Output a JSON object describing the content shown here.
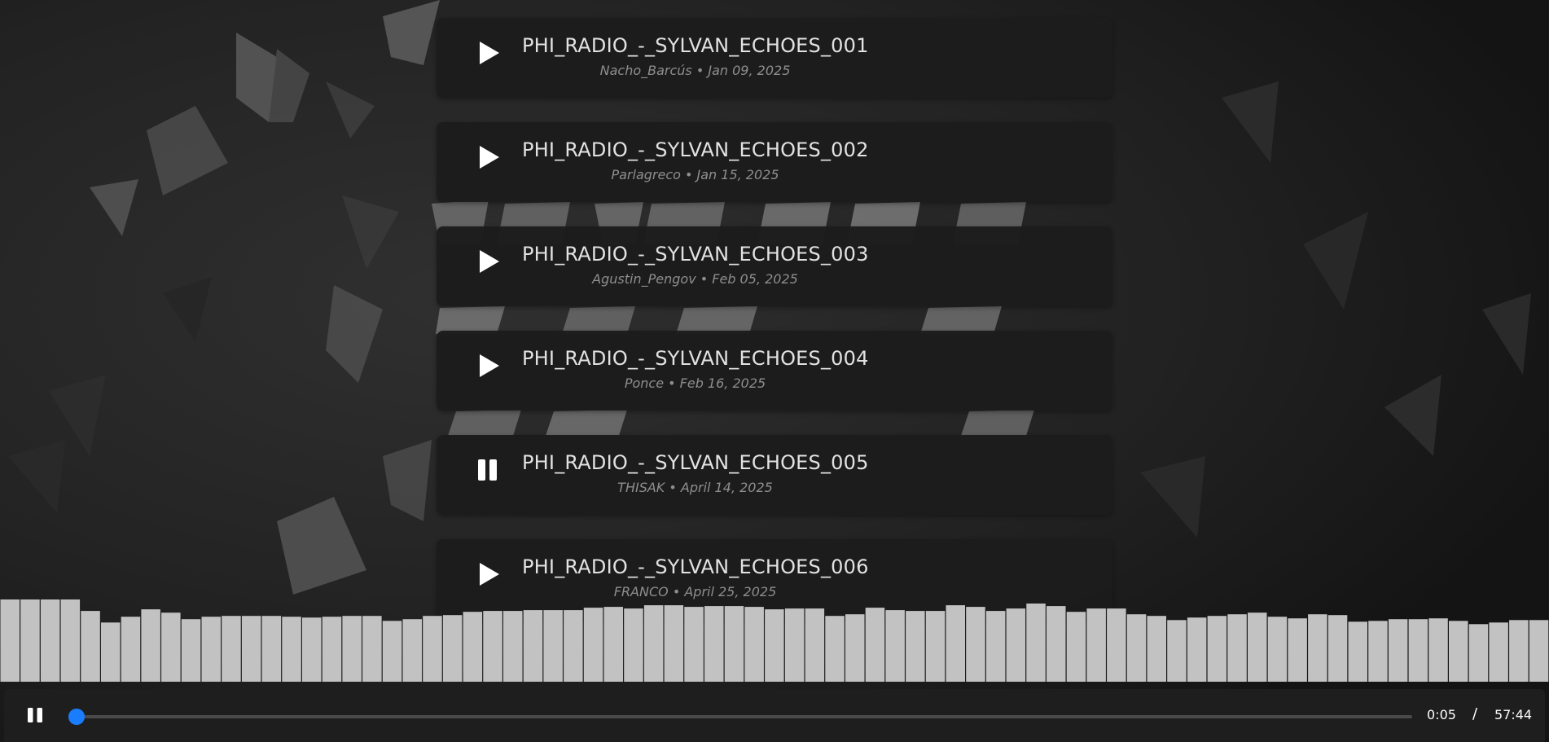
{
  "background": {
    "facets": [
      [
        [
          290,
          40
        ],
        [
          340,
          70
        ],
        [
          330,
          150
        ],
        [
          290,
          120
        ],
        "#5a5a5a"
      ],
      [
        [
          340,
          60
        ],
        [
          380,
          90
        ],
        [
          360,
          150
        ],
        [
          330,
          150
        ],
        "#4a4a4a"
      ],
      [
        [
          470,
          20
        ],
        [
          540,
          0
        ],
        [
          520,
          80
        ],
        [
          480,
          70
        ],
        "#5e5e5e"
      ],
      [
        [
          180,
          160
        ],
        [
          240,
          130
        ],
        [
          280,
          200
        ],
        [
          200,
          240
        ],
        "#4c4c4c"
      ],
      [
        [
          110,
          230
        ],
        [
          170,
          220
        ],
        [
          150,
          290
        ],
        "#555555"
      ],
      [
        [
          400,
          100
        ],
        [
          460,
          130
        ],
        [
          430,
          170
        ],
        "#3e3e3e"
      ],
      [
        [
          420,
          240
        ],
        [
          490,
          260
        ],
        [
          450,
          330
        ],
        "#3a3a3a"
      ],
      [
        [
          410,
          350
        ],
        [
          470,
          380
        ],
        [
          440,
          470
        ],
        [
          400,
          430
        ],
        "#4e4e4e"
      ],
      [
        [
          340,
          640
        ],
        [
          410,
          610
        ],
        [
          450,
          700
        ],
        [
          360,
          730
        ],
        "#555555"
      ],
      [
        [
          470,
          560
        ],
        [
          530,
          540
        ],
        [
          520,
          640
        ],
        [
          480,
          620
        ],
        "#4a4a4a"
      ],
      [
        [
          530,
          250
        ],
        [
          600,
          245
        ],
        [
          590,
          300
        ],
        [
          540,
          300
        ],
        "#6e6e6e"
      ],
      [
        [
          620,
          250
        ],
        [
          700,
          248
        ],
        [
          690,
          300
        ],
        [
          610,
          300
        ],
        "#6a6a6a"
      ],
      [
        [
          730,
          250
        ],
        [
          790,
          248
        ],
        [
          780,
          300
        ],
        [
          740,
          300
        ],
        "#707070"
      ],
      [
        [
          800,
          250
        ],
        [
          890,
          248
        ],
        [
          880,
          300
        ],
        [
          790,
          300
        ],
        "#6c6c6c"
      ],
      [
        [
          940,
          250
        ],
        [
          1020,
          248
        ],
        [
          1010,
          300
        ],
        [
          930,
          300
        ],
        "#747474"
      ],
      [
        [
          1050,
          250
        ],
        [
          1130,
          248
        ],
        [
          1120,
          300
        ],
        [
          1040,
          300
        ],
        "#7a7a7a"
      ],
      [
        [
          1180,
          250
        ],
        [
          1260,
          248
        ],
        [
          1250,
          300
        ],
        [
          1170,
          300
        ],
        "#686868"
      ],
      [
        [
          540,
          378
        ],
        [
          620,
          376
        ],
        [
          610,
          410
        ],
        [
          535,
          410
        ],
        "#767676"
      ],
      [
        [
          700,
          378
        ],
        [
          780,
          376
        ],
        [
          770,
          410
        ],
        [
          690,
          410
        ],
        "#6a6a6a"
      ],
      [
        [
          840,
          378
        ],
        [
          930,
          376
        ],
        [
          920,
          410
        ],
        [
          830,
          410
        ],
        "#707070"
      ],
      [
        [
          1140,
          378
        ],
        [
          1230,
          376
        ],
        [
          1220,
          410
        ],
        [
          1130,
          410
        ],
        "#6e6e6e"
      ],
      [
        [
          560,
          505
        ],
        [
          640,
          503
        ],
        [
          630,
          535
        ],
        [
          550,
          535
        ],
        "#6a6a6a"
      ],
      [
        [
          680,
          505
        ],
        [
          770,
          503
        ],
        [
          760,
          535
        ],
        [
          670,
          535
        ],
        "#727272"
      ],
      [
        [
          1190,
          505
        ],
        [
          1270,
          503
        ],
        [
          1260,
          535
        ],
        [
          1180,
          535
        ],
        "#6a6a6a"
      ],
      [
        [
          1500,
          120
        ],
        [
          1570,
          100
        ],
        [
          1560,
          200
        ],
        "#2e2e2e"
      ],
      [
        [
          1600,
          300
        ],
        [
          1680,
          260
        ],
        [
          1650,
          380
        ],
        "#2a2a2a"
      ],
      [
        [
          1700,
          500
        ],
        [
          1770,
          460
        ],
        [
          1760,
          560
        ],
        "#303030"
      ],
      [
        [
          1400,
          580
        ],
        [
          1480,
          560
        ],
        [
          1470,
          660
        ],
        "#2c2c2c"
      ],
      [
        [
          1820,
          380
        ],
        [
          1880,
          360
        ],
        [
          1870,
          460
        ],
        "#2e2e2e"
      ],
      [
        [
          60,
          480
        ],
        [
          130,
          460
        ],
        [
          110,
          560
        ],
        "#2e2e2e"
      ],
      [
        [
          10,
          560
        ],
        [
          80,
          540
        ],
        [
          70,
          630
        ],
        "#2a2a2a"
      ],
      [
        [
          200,
          360
        ],
        [
          260,
          340
        ],
        [
          240,
          420
        ],
        "#262626"
      ]
    ]
  },
  "tracks": [
    {
      "title": "PHI_RADIO_-_SYLVAN_ECHOES_001",
      "meta": "Nacho_Barcús • Jan 09, 2025",
      "state": "play"
    },
    {
      "title": "PHI_RADIO_-_SYLVAN_ECHOES_002",
      "meta": "Parlagreco • Jan 15, 2025",
      "state": "play"
    },
    {
      "title": "PHI_RADIO_-_SYLVAN_ECHOES_003",
      "meta": "Agustin_Pengov • Feb 05, 2025",
      "state": "play"
    },
    {
      "title": "PHI_RADIO_-_SYLVAN_ECHOES_004",
      "meta": "Ponce • Feb 16, 2025",
      "state": "play"
    },
    {
      "title": "PHI_RADIO_-_SYLVAN_ECHOES_005",
      "meta": "THISAK • April 14, 2025",
      "state": "pause"
    },
    {
      "title": "PHI_RADIO_-_SYLVAN_ECHOES_006",
      "meta": "FRANCO • April 25, 2025",
      "state": "play"
    }
  ],
  "visualizer": {
    "bar_color": "#c2c2c2",
    "levels": [
      100,
      100,
      100,
      100,
      86,
      72,
      79,
      88,
      84,
      76,
      79,
      80,
      80,
      80,
      79,
      78,
      79,
      80,
      80,
      74,
      76,
      80,
      81,
      85,
      86,
      86,
      87,
      87,
      87,
      90,
      91,
      89,
      93,
      93,
      91,
      92,
      92,
      91,
      88,
      89,
      89,
      80,
      82,
      90,
      87,
      86,
      86,
      93,
      91,
      86,
      89,
      95,
      92,
      85,
      89,
      89,
      82,
      80,
      75,
      78,
      80,
      82,
      84,
      79,
      77,
      82,
      81,
      73,
      74,
      76,
      76,
      77,
      74,
      70,
      72,
      75,
      75
    ]
  },
  "player": {
    "state_icon": "pause-icon",
    "current_time": "0:05",
    "separator": "/",
    "total_time": "57:44",
    "progress": 0.0014,
    "accent": "#1a7cff"
  }
}
